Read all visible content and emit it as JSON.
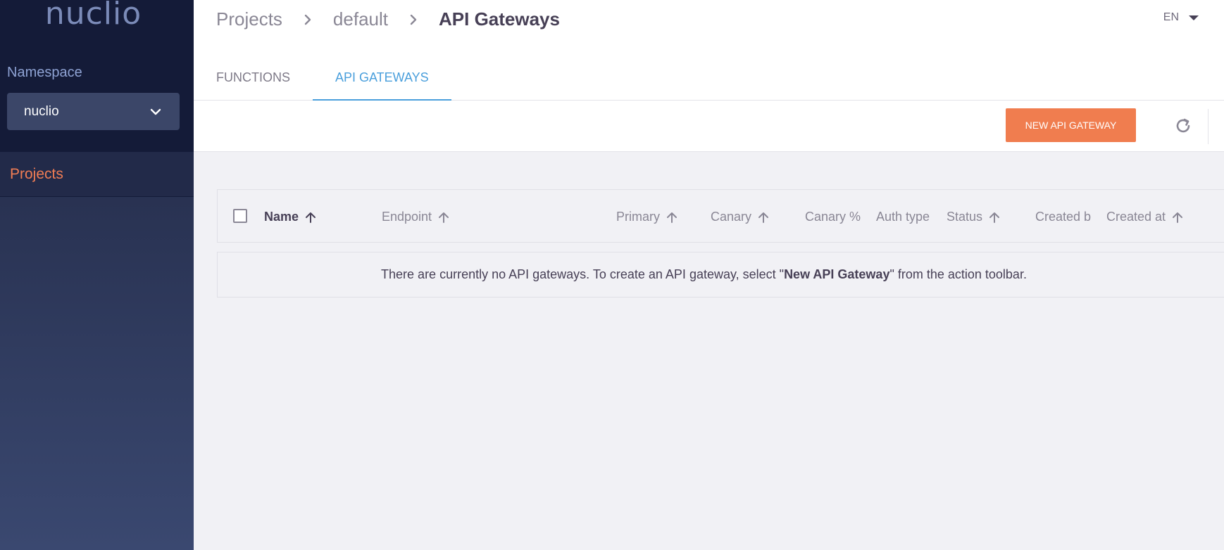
{
  "sidebar": {
    "logo": "nuclio",
    "namespace_label": "Namespace",
    "namespace_value": "nuclio",
    "nav_items": [
      {
        "label": "Projects",
        "active": true
      }
    ]
  },
  "header": {
    "breadcrumb": [
      "Projects",
      "default",
      "API Gateways"
    ],
    "language": "EN",
    "tabs": [
      {
        "label": "FUNCTIONS",
        "active": false
      },
      {
        "label": "API GATEWAYS",
        "active": true
      }
    ]
  },
  "toolbar": {
    "new_button_label": "NEW API GATEWAY"
  },
  "table": {
    "columns": [
      "Name",
      "Endpoint",
      "Primary",
      "Canary",
      "Canary %",
      "Auth type",
      "Status",
      "Created b",
      "Created at"
    ],
    "empty_message": {
      "before": "There are currently no API gateways. To create an API gateway, select \"",
      "emphasis": "New API Gateway",
      "after": "\" from the action toolbar."
    }
  },
  "colors": {
    "accent": "#f07d4f",
    "tab_active": "#4a9fdc",
    "sidebar_bg": "#1b2242"
  },
  "icons": [
    "chevron-down-icon",
    "chevron-right-icon",
    "caret-down-icon",
    "refresh-icon",
    "sort-arrow-up-icon"
  ]
}
